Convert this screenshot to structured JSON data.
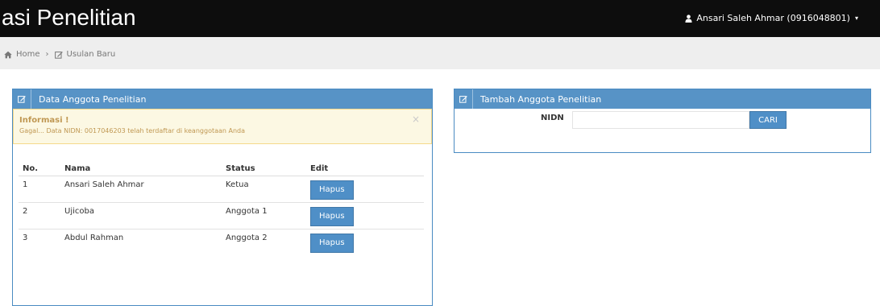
{
  "header": {
    "app_title": "asi Penelitian",
    "user_label": "Ansari Saleh Ahmar (0916048801)",
    "caret": "▾"
  },
  "breadcrumb": {
    "home": "Home",
    "separator": "›",
    "current": "Usulan Baru"
  },
  "left_panel": {
    "title": "Data Anggota Penelitian",
    "alert": {
      "title": "Informasi !",
      "message": "Gagal... Data NIDN: 0017046203 telah terdaftar di keanggotaan Anda",
      "close": "×"
    },
    "table": {
      "headers": [
        "No.",
        "Nama",
        "Status",
        "Edit"
      ],
      "rows": [
        {
          "no": "1",
          "nama": "Ansari Saleh Ahmar",
          "status": "Ketua",
          "action": "Hapus"
        },
        {
          "no": "2",
          "nama": "Ujicoba",
          "status": "Anggota 1",
          "action": "Hapus"
        },
        {
          "no": "3",
          "nama": "Abdul Rahman",
          "status": "Anggota 2",
          "action": "Hapus"
        }
      ]
    }
  },
  "right_panel": {
    "title": "Tambah Anggota Penelitian",
    "nidn_label": "NIDN",
    "nidn_value": "",
    "search_button": "CARI"
  },
  "colors": {
    "topbar": "#0d0d0d",
    "panel_header": "#5793c6",
    "button": "#4f8fc7",
    "alert_bg": "#fcf8e3",
    "alert_text": "#c09853"
  },
  "icons": {
    "user": "user-icon",
    "home": "home-icon",
    "edit": "edit-icon"
  }
}
